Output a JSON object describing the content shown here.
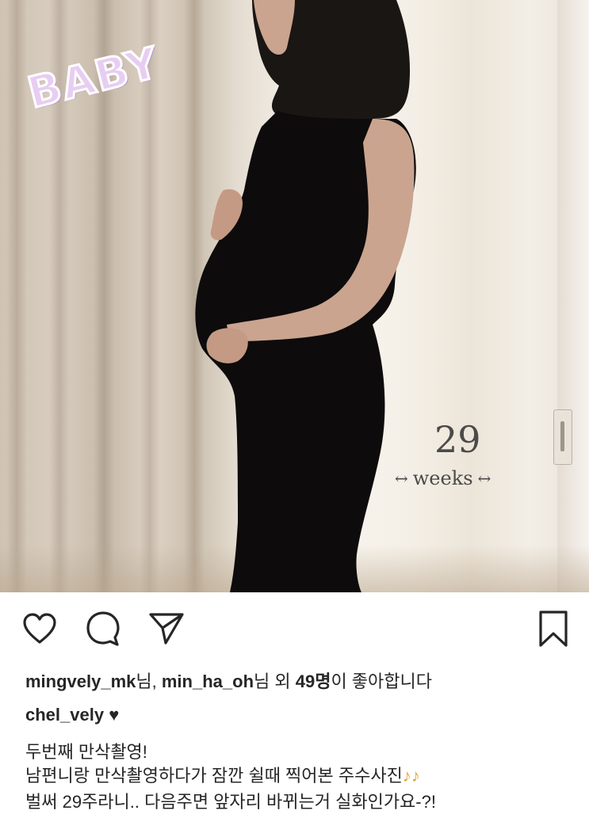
{
  "photo": {
    "sticker_title": "BABY",
    "weeks_number": "29",
    "weeks_label": "weeks"
  },
  "actions": {
    "like_icon": "heart-outline-icon",
    "comment_icon": "comment-bubble-icon",
    "share_icon": "paper-plane-icon",
    "save_icon": "bookmark-icon"
  },
  "likes": {
    "user1": "mingvely_mk",
    "suffix1": "님, ",
    "user2": "min_ha_oh",
    "suffix2": "님 외 ",
    "count": "49명",
    "tail": "이 좋아합니다"
  },
  "caption": {
    "username": "chel_vely",
    "heart": "♥",
    "line1": "두번째 만삭촬영!",
    "line2": "남편니랑 만삭촬영하다가 잠깐 쉴때 찍어본 주수사진",
    "line2_notes": "♪♪",
    "line3": "벌써 29주라니.. 다음주면 앞자리 바뀌는거 실화인가요-?!"
  }
}
